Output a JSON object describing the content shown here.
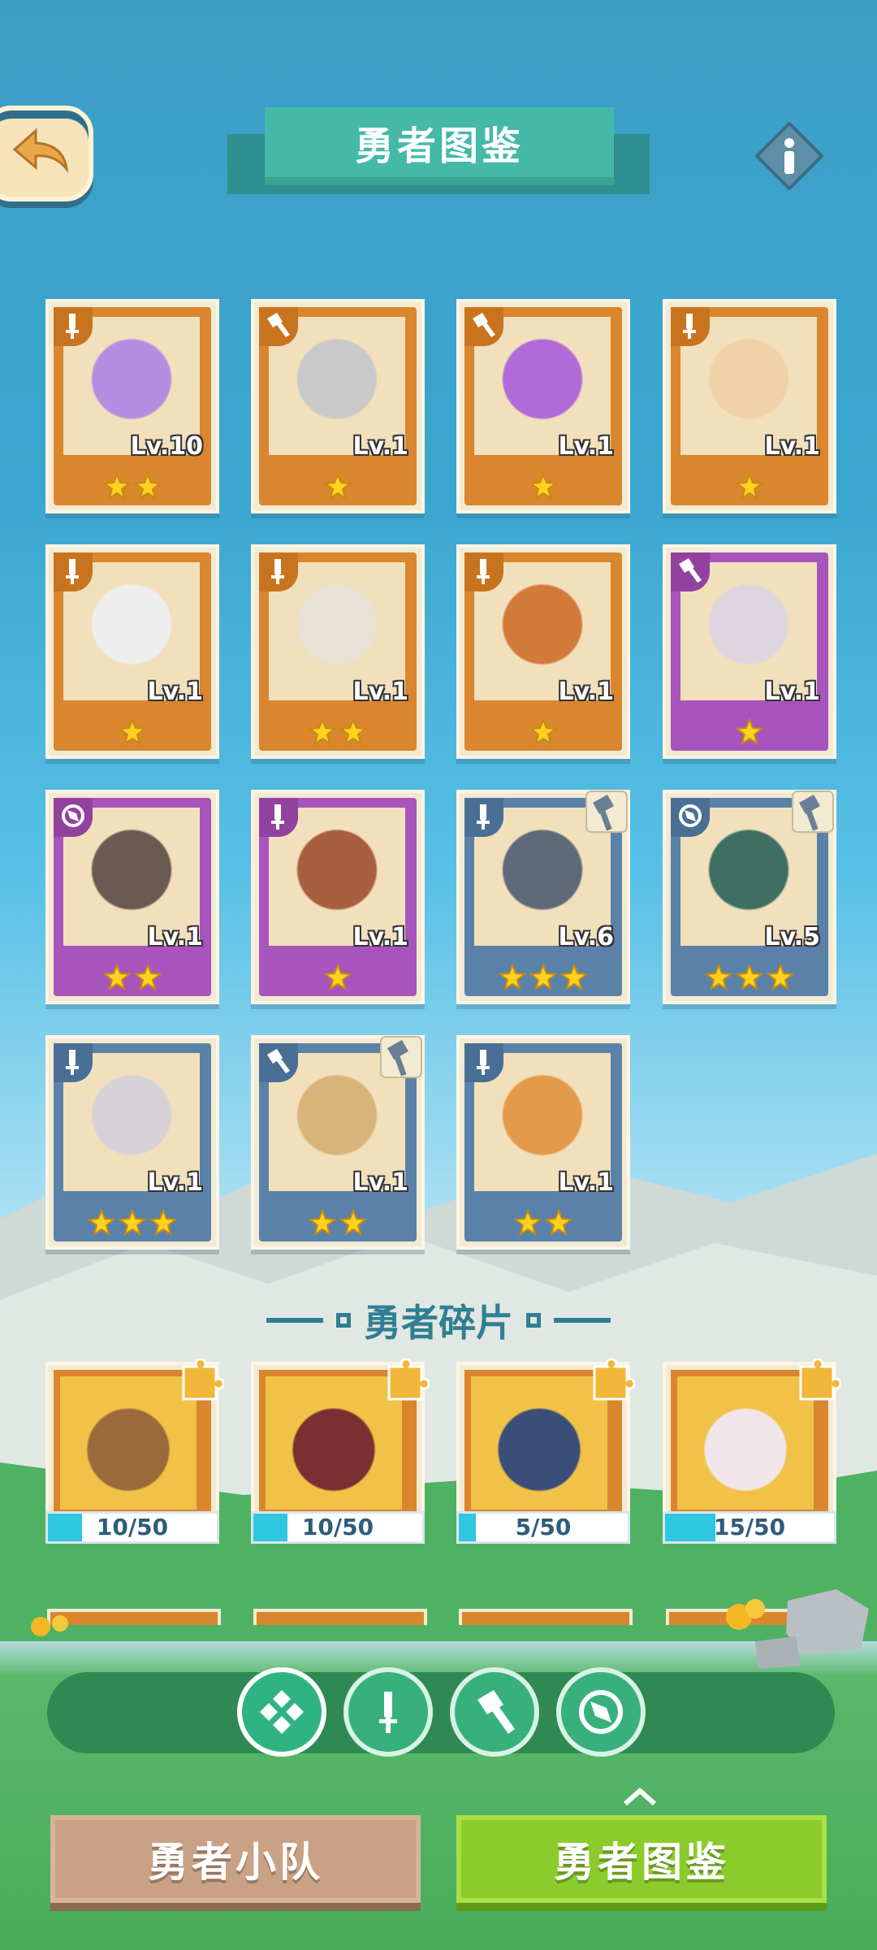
{
  "header": {
    "title": "勇者图鉴"
  },
  "heroes": [
    {
      "level": "Lv.10",
      "stars": 2,
      "rarity": "orange",
      "class": "sword",
      "badge": false
    },
    {
      "level": "Lv.1",
      "stars": 1,
      "rarity": "orange",
      "class": "hammer",
      "badge": false
    },
    {
      "level": "Lv.1",
      "stars": 1,
      "rarity": "orange",
      "class": "hammer",
      "badge": false
    },
    {
      "level": "Lv.1",
      "stars": 1,
      "rarity": "orange",
      "class": "sword",
      "badge": false
    },
    {
      "level": "Lv.1",
      "stars": 1,
      "rarity": "orange",
      "class": "sword",
      "badge": false
    },
    {
      "level": "Lv.1",
      "stars": 2,
      "rarity": "orange",
      "class": "sword",
      "badge": false
    },
    {
      "level": "Lv.1",
      "stars": 1,
      "rarity": "orange",
      "class": "sword",
      "badge": false
    },
    {
      "level": "Lv.1",
      "stars": 1,
      "rarity": "purple",
      "class": "hammer",
      "badge": false
    },
    {
      "level": "Lv.1",
      "stars": 2,
      "rarity": "purple",
      "class": "compass",
      "badge": false
    },
    {
      "level": "Lv.1",
      "stars": 1,
      "rarity": "purple",
      "class": "sword",
      "badge": false
    },
    {
      "level": "Lv.6",
      "stars": 3,
      "rarity": "blue",
      "class": "sword",
      "badge": true
    },
    {
      "level": "Lv.5",
      "stars": 3,
      "rarity": "blue",
      "class": "compass",
      "badge": true
    },
    {
      "level": "Lv.1",
      "stars": 3,
      "rarity": "blue",
      "class": "sword",
      "badge": false
    },
    {
      "level": "Lv.1",
      "stars": 2,
      "rarity": "blue",
      "class": "hammer",
      "badge": true
    },
    {
      "level": "Lv.1",
      "stars": 2,
      "rarity": "blue",
      "class": "sword",
      "badge": false
    }
  ],
  "shards_section": {
    "title": "勇者碎片"
  },
  "shards": [
    {
      "progress": "10/50",
      "fraction": 0.2
    },
    {
      "progress": "10/50",
      "fraction": 0.2
    },
    {
      "progress": "5/50",
      "fraction": 0.1
    },
    {
      "progress": "15/50",
      "fraction": 0.3
    }
  ],
  "filters": [
    "all-icon",
    "sword-icon",
    "hammer-icon",
    "compass-icon"
  ],
  "bottom": {
    "team_label": "勇者小队",
    "dex_label": "勇者图鉴"
  },
  "colors": {
    "orange": "#d9862e",
    "purple": "#a854bd",
    "blue": "#5a82a9",
    "accent_green": "#8bcc2c"
  }
}
